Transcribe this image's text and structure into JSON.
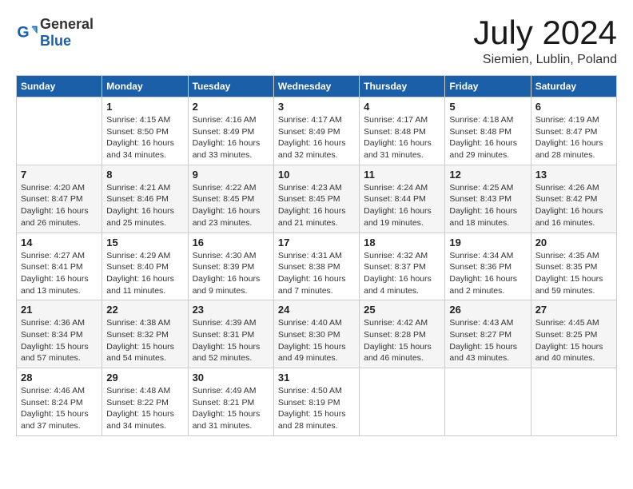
{
  "header": {
    "logo_general": "General",
    "logo_blue": "Blue",
    "month_title": "July 2024",
    "location": "Siemien, Lublin, Poland"
  },
  "calendar": {
    "days_of_week": [
      "Sunday",
      "Monday",
      "Tuesday",
      "Wednesday",
      "Thursday",
      "Friday",
      "Saturday"
    ],
    "weeks": [
      [
        {
          "day": "",
          "info": ""
        },
        {
          "day": "1",
          "info": "Sunrise: 4:15 AM\nSunset: 8:50 PM\nDaylight: 16 hours\nand 34 minutes."
        },
        {
          "day": "2",
          "info": "Sunrise: 4:16 AM\nSunset: 8:49 PM\nDaylight: 16 hours\nand 33 minutes."
        },
        {
          "day": "3",
          "info": "Sunrise: 4:17 AM\nSunset: 8:49 PM\nDaylight: 16 hours\nand 32 minutes."
        },
        {
          "day": "4",
          "info": "Sunrise: 4:17 AM\nSunset: 8:48 PM\nDaylight: 16 hours\nand 31 minutes."
        },
        {
          "day": "5",
          "info": "Sunrise: 4:18 AM\nSunset: 8:48 PM\nDaylight: 16 hours\nand 29 minutes."
        },
        {
          "day": "6",
          "info": "Sunrise: 4:19 AM\nSunset: 8:47 PM\nDaylight: 16 hours\nand 28 minutes."
        }
      ],
      [
        {
          "day": "7",
          "info": "Sunrise: 4:20 AM\nSunset: 8:47 PM\nDaylight: 16 hours\nand 26 minutes."
        },
        {
          "day": "8",
          "info": "Sunrise: 4:21 AM\nSunset: 8:46 PM\nDaylight: 16 hours\nand 25 minutes."
        },
        {
          "day": "9",
          "info": "Sunrise: 4:22 AM\nSunset: 8:45 PM\nDaylight: 16 hours\nand 23 minutes."
        },
        {
          "day": "10",
          "info": "Sunrise: 4:23 AM\nSunset: 8:45 PM\nDaylight: 16 hours\nand 21 minutes."
        },
        {
          "day": "11",
          "info": "Sunrise: 4:24 AM\nSunset: 8:44 PM\nDaylight: 16 hours\nand 19 minutes."
        },
        {
          "day": "12",
          "info": "Sunrise: 4:25 AM\nSunset: 8:43 PM\nDaylight: 16 hours\nand 18 minutes."
        },
        {
          "day": "13",
          "info": "Sunrise: 4:26 AM\nSunset: 8:42 PM\nDaylight: 16 hours\nand 16 minutes."
        }
      ],
      [
        {
          "day": "14",
          "info": "Sunrise: 4:27 AM\nSunset: 8:41 PM\nDaylight: 16 hours\nand 13 minutes."
        },
        {
          "day": "15",
          "info": "Sunrise: 4:29 AM\nSunset: 8:40 PM\nDaylight: 16 hours\nand 11 minutes."
        },
        {
          "day": "16",
          "info": "Sunrise: 4:30 AM\nSunset: 8:39 PM\nDaylight: 16 hours\nand 9 minutes."
        },
        {
          "day": "17",
          "info": "Sunrise: 4:31 AM\nSunset: 8:38 PM\nDaylight: 16 hours\nand 7 minutes."
        },
        {
          "day": "18",
          "info": "Sunrise: 4:32 AM\nSunset: 8:37 PM\nDaylight: 16 hours\nand 4 minutes."
        },
        {
          "day": "19",
          "info": "Sunrise: 4:34 AM\nSunset: 8:36 PM\nDaylight: 16 hours\nand 2 minutes."
        },
        {
          "day": "20",
          "info": "Sunrise: 4:35 AM\nSunset: 8:35 PM\nDaylight: 15 hours\nand 59 minutes."
        }
      ],
      [
        {
          "day": "21",
          "info": "Sunrise: 4:36 AM\nSunset: 8:34 PM\nDaylight: 15 hours\nand 57 minutes."
        },
        {
          "day": "22",
          "info": "Sunrise: 4:38 AM\nSunset: 8:32 PM\nDaylight: 15 hours\nand 54 minutes."
        },
        {
          "day": "23",
          "info": "Sunrise: 4:39 AM\nSunset: 8:31 PM\nDaylight: 15 hours\nand 52 minutes."
        },
        {
          "day": "24",
          "info": "Sunrise: 4:40 AM\nSunset: 8:30 PM\nDaylight: 15 hours\nand 49 minutes."
        },
        {
          "day": "25",
          "info": "Sunrise: 4:42 AM\nSunset: 8:28 PM\nDaylight: 15 hours\nand 46 minutes."
        },
        {
          "day": "26",
          "info": "Sunrise: 4:43 AM\nSunset: 8:27 PM\nDaylight: 15 hours\nand 43 minutes."
        },
        {
          "day": "27",
          "info": "Sunrise: 4:45 AM\nSunset: 8:25 PM\nDaylight: 15 hours\nand 40 minutes."
        }
      ],
      [
        {
          "day": "28",
          "info": "Sunrise: 4:46 AM\nSunset: 8:24 PM\nDaylight: 15 hours\nand 37 minutes."
        },
        {
          "day": "29",
          "info": "Sunrise: 4:48 AM\nSunset: 8:22 PM\nDaylight: 15 hours\nand 34 minutes."
        },
        {
          "day": "30",
          "info": "Sunrise: 4:49 AM\nSunset: 8:21 PM\nDaylight: 15 hours\nand 31 minutes."
        },
        {
          "day": "31",
          "info": "Sunrise: 4:50 AM\nSunset: 8:19 PM\nDaylight: 15 hours\nand 28 minutes."
        },
        {
          "day": "",
          "info": ""
        },
        {
          "day": "",
          "info": ""
        },
        {
          "day": "",
          "info": ""
        }
      ]
    ]
  }
}
